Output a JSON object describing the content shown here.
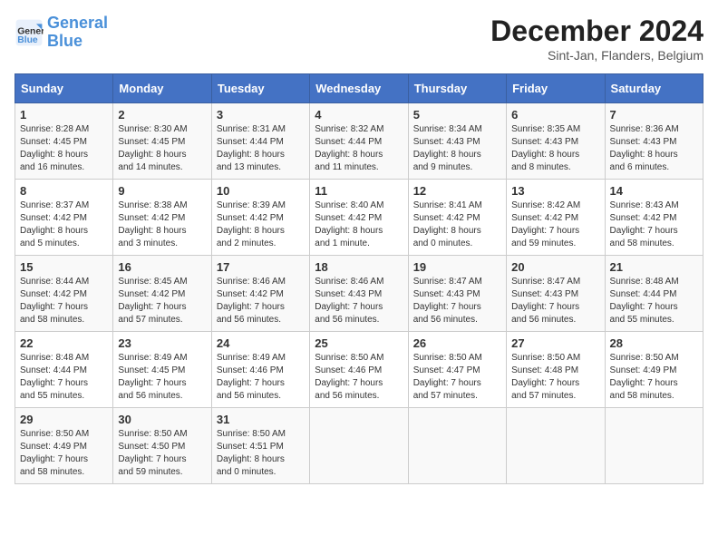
{
  "logo": {
    "line1": "General",
    "line2": "Blue"
  },
  "title": "December 2024",
  "subtitle": "Sint-Jan, Flanders, Belgium",
  "columns": [
    "Sunday",
    "Monday",
    "Tuesday",
    "Wednesday",
    "Thursday",
    "Friday",
    "Saturday"
  ],
  "weeks": [
    [
      {
        "num": "1",
        "sunrise": "8:28 AM",
        "sunset": "4:45 PM",
        "daylight": "8 hours and 16 minutes."
      },
      {
        "num": "2",
        "sunrise": "8:30 AM",
        "sunset": "4:45 PM",
        "daylight": "8 hours and 14 minutes."
      },
      {
        "num": "3",
        "sunrise": "8:31 AM",
        "sunset": "4:44 PM",
        "daylight": "8 hours and 13 minutes."
      },
      {
        "num": "4",
        "sunrise": "8:32 AM",
        "sunset": "4:44 PM",
        "daylight": "8 hours and 11 minutes."
      },
      {
        "num": "5",
        "sunrise": "8:34 AM",
        "sunset": "4:43 PM",
        "daylight": "8 hours and 9 minutes."
      },
      {
        "num": "6",
        "sunrise": "8:35 AM",
        "sunset": "4:43 PM",
        "daylight": "8 hours and 8 minutes."
      },
      {
        "num": "7",
        "sunrise": "8:36 AM",
        "sunset": "4:43 PM",
        "daylight": "8 hours and 6 minutes."
      }
    ],
    [
      {
        "num": "8",
        "sunrise": "8:37 AM",
        "sunset": "4:42 PM",
        "daylight": "8 hours and 5 minutes."
      },
      {
        "num": "9",
        "sunrise": "8:38 AM",
        "sunset": "4:42 PM",
        "daylight": "8 hours and 3 minutes."
      },
      {
        "num": "10",
        "sunrise": "8:39 AM",
        "sunset": "4:42 PM",
        "daylight": "8 hours and 2 minutes."
      },
      {
        "num": "11",
        "sunrise": "8:40 AM",
        "sunset": "4:42 PM",
        "daylight": "8 hours and 1 minute."
      },
      {
        "num": "12",
        "sunrise": "8:41 AM",
        "sunset": "4:42 PM",
        "daylight": "8 hours and 0 minutes."
      },
      {
        "num": "13",
        "sunrise": "8:42 AM",
        "sunset": "4:42 PM",
        "daylight": "7 hours and 59 minutes."
      },
      {
        "num": "14",
        "sunrise": "8:43 AM",
        "sunset": "4:42 PM",
        "daylight": "7 hours and 58 minutes."
      }
    ],
    [
      {
        "num": "15",
        "sunrise": "8:44 AM",
        "sunset": "4:42 PM",
        "daylight": "7 hours and 58 minutes."
      },
      {
        "num": "16",
        "sunrise": "8:45 AM",
        "sunset": "4:42 PM",
        "daylight": "7 hours and 57 minutes."
      },
      {
        "num": "17",
        "sunrise": "8:46 AM",
        "sunset": "4:42 PM",
        "daylight": "7 hours and 56 minutes."
      },
      {
        "num": "18",
        "sunrise": "8:46 AM",
        "sunset": "4:43 PM",
        "daylight": "7 hours and 56 minutes."
      },
      {
        "num": "19",
        "sunrise": "8:47 AM",
        "sunset": "4:43 PM",
        "daylight": "7 hours and 56 minutes."
      },
      {
        "num": "20",
        "sunrise": "8:47 AM",
        "sunset": "4:43 PM",
        "daylight": "7 hours and 56 minutes."
      },
      {
        "num": "21",
        "sunrise": "8:48 AM",
        "sunset": "4:44 PM",
        "daylight": "7 hours and 55 minutes."
      }
    ],
    [
      {
        "num": "22",
        "sunrise": "8:48 AM",
        "sunset": "4:44 PM",
        "daylight": "7 hours and 55 minutes."
      },
      {
        "num": "23",
        "sunrise": "8:49 AM",
        "sunset": "4:45 PM",
        "daylight": "7 hours and 56 minutes."
      },
      {
        "num": "24",
        "sunrise": "8:49 AM",
        "sunset": "4:46 PM",
        "daylight": "7 hours and 56 minutes."
      },
      {
        "num": "25",
        "sunrise": "8:50 AM",
        "sunset": "4:46 PM",
        "daylight": "7 hours and 56 minutes."
      },
      {
        "num": "26",
        "sunrise": "8:50 AM",
        "sunset": "4:47 PM",
        "daylight": "7 hours and 57 minutes."
      },
      {
        "num": "27",
        "sunrise": "8:50 AM",
        "sunset": "4:48 PM",
        "daylight": "7 hours and 57 minutes."
      },
      {
        "num": "28",
        "sunrise": "8:50 AM",
        "sunset": "4:49 PM",
        "daylight": "7 hours and 58 minutes."
      }
    ],
    [
      {
        "num": "29",
        "sunrise": "8:50 AM",
        "sunset": "4:49 PM",
        "daylight": "7 hours and 58 minutes."
      },
      {
        "num": "30",
        "sunrise": "8:50 AM",
        "sunset": "4:50 PM",
        "daylight": "7 hours and 59 minutes."
      },
      {
        "num": "31",
        "sunrise": "8:50 AM",
        "sunset": "4:51 PM",
        "daylight": "8 hours and 0 minutes."
      },
      null,
      null,
      null,
      null
    ]
  ]
}
